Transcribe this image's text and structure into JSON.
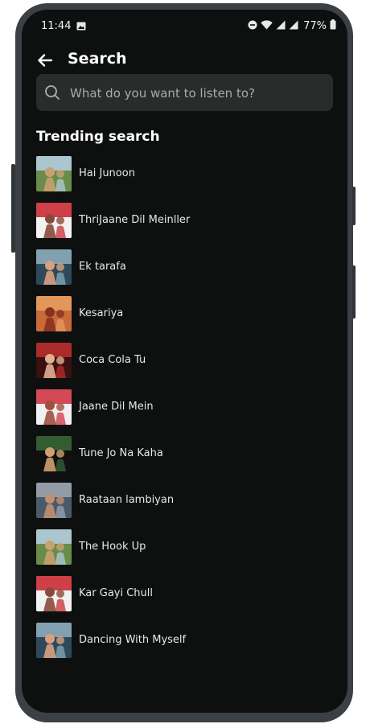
{
  "status_bar": {
    "time": "11:44",
    "battery": "77%",
    "icons": [
      "image-icon",
      "dnd-icon",
      "wifi-icon",
      "signal-icon",
      "signal-icon",
      "battery-icon"
    ]
  },
  "header": {
    "back_icon": "arrow-left-icon",
    "title": "Search"
  },
  "search": {
    "icon": "search-icon",
    "placeholder": "What do you want to listen to?",
    "value": ""
  },
  "trending": {
    "title": "Trending search",
    "items": [
      {
        "label": "Hai Junoon",
        "thumb_colors": [
          "#6a8c4a",
          "#b7d0e6",
          "#c9a070"
        ]
      },
      {
        "label": "ThriJaane Dil Meinller",
        "thumb_colors": [
          "#f2f2f2",
          "#c9202a",
          "#8a4a3a"
        ]
      },
      {
        "label": "Ek tarafa",
        "thumb_colors": [
          "#2e4a5a",
          "#8fb0c0",
          "#d9a080"
        ]
      },
      {
        "label": "Kesariya",
        "thumb_colors": [
          "#c86a3a",
          "#e8a060",
          "#8a3020"
        ]
      },
      {
        "label": "Coca Cola Tu",
        "thumb_colors": [
          "#3a1010",
          "#c03030",
          "#e0b090"
        ]
      },
      {
        "label": "Jaane Dil Mein",
        "thumb_colors": [
          "#f0f0f0",
          "#d02a3a",
          "#a05040"
        ]
      },
      {
        "label": "Tune Jo Na Kaha",
        "thumb_colors": [
          "#101010",
          "#3a6a3a",
          "#d0a070"
        ]
      },
      {
        "label": "Raataan lambiyan",
        "thumb_colors": [
          "#4a5a6a",
          "#a0a8b0",
          "#c09070"
        ]
      },
      {
        "label": "The Hook Up",
        "thumb_colors": [
          "#6a8c4a",
          "#b7d0e6",
          "#c9a070"
        ]
      },
      {
        "label": "Kar Gayi Chull",
        "thumb_colors": [
          "#f2f2f2",
          "#c9202a",
          "#8a4a3a"
        ]
      },
      {
        "label": "Dancing With Myself",
        "thumb_colors": [
          "#2e4a5a",
          "#8fb0c0",
          "#d9a080"
        ]
      }
    ]
  },
  "colors": {
    "screen_bg": "#0d100f",
    "search_bg": "#2a2c2c",
    "frame": "#3a4044"
  }
}
